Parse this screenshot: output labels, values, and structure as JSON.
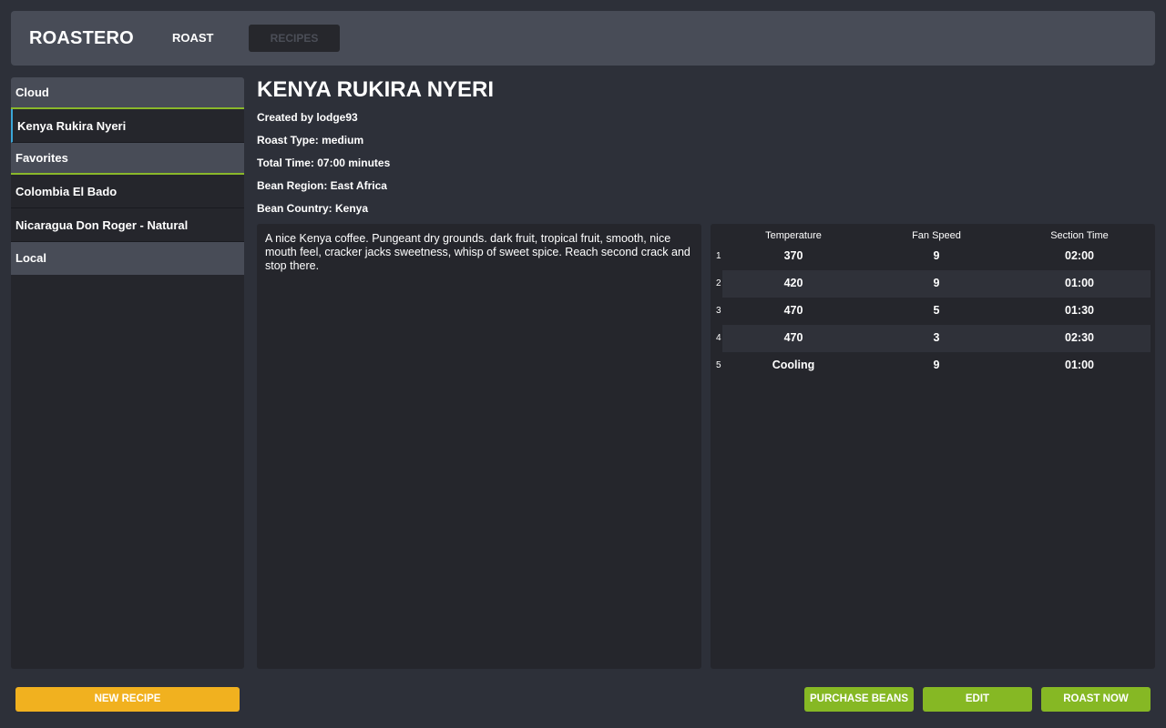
{
  "app": {
    "brand": "ROASTERO",
    "nav": {
      "roast": "ROAST",
      "recipes": "RECIPES"
    }
  },
  "sidebar": {
    "cloud_header": "Cloud",
    "cloud_items": [
      "Kenya Rukira Nyeri"
    ],
    "favorites_header": "Favorites",
    "favorites_items": [
      "Colombia El Bado",
      "Nicaragua Don Roger - Natural"
    ],
    "local_header": "Local"
  },
  "recipe": {
    "title": "KENYA RUKIRA NYERI",
    "created_by": "Created by lodge93",
    "roast_type": "Roast Type: medium",
    "total_time": "Total Time: 07:00 minutes",
    "bean_region": "Bean Region: East Africa",
    "bean_country": "Bean Country: Kenya",
    "description": "A nice Kenya coffee. Pungeant dry grounds. dark fruit, tropical fruit, smooth, nice mouth feel, cracker jacks sweetness, whisp of sweet spice. Reach second crack and stop there."
  },
  "steps_table": {
    "headers": [
      "Temperature",
      "Fan Speed",
      "Section Time"
    ],
    "rows": [
      {
        "num": "1",
        "temperature": "370",
        "fan": "9",
        "time": "02:00"
      },
      {
        "num": "2",
        "temperature": "420",
        "fan": "9",
        "time": "01:00"
      },
      {
        "num": "3",
        "temperature": "470",
        "fan": "5",
        "time": "01:30"
      },
      {
        "num": "4",
        "temperature": "470",
        "fan": "3",
        "time": "02:30"
      },
      {
        "num": "5",
        "temperature": "Cooling",
        "fan": "9",
        "time": "01:00"
      }
    ]
  },
  "actions": {
    "new_recipe": "NEW RECIPE",
    "purchase_beans": "PURCHASE BEANS",
    "edit": "EDIT",
    "roast_now": "ROAST NOW"
  },
  "colors": {
    "background": "#2d3039",
    "panel": "#25262c",
    "header": "#484c57",
    "accent_green": "#86b824",
    "accent_orange": "#f1b11f",
    "active_blue": "#3aa6d8"
  }
}
